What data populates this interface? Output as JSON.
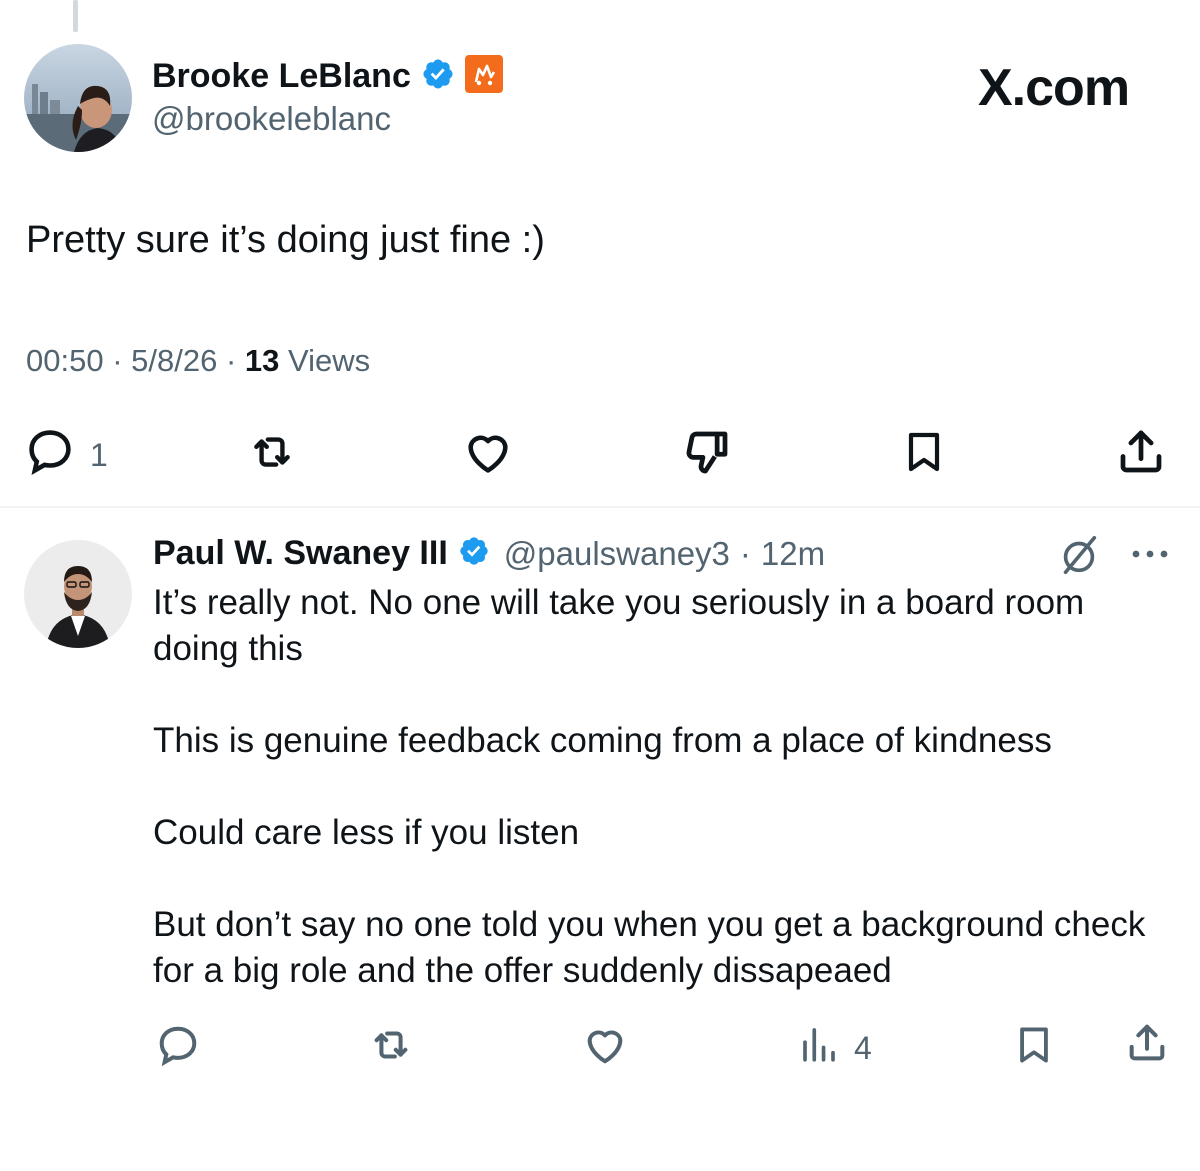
{
  "brand": {
    "logo_text": "X.com"
  },
  "main_post": {
    "author_name": "Brooke LeBlanc",
    "handle": "@brookeleblanc",
    "text": "Pretty sure it’s doing just fine :)",
    "time": "00:50",
    "date": "5/8/26",
    "views_count": "13",
    "views_label": "Views",
    "reply_count": "1"
  },
  "reply": {
    "author_name": "Paul W. Swaney III",
    "handle": "@paulswaney3",
    "time_ago": "12m",
    "paragraphs": [
      "It’s really not. No one will take you seriously in a board room doing this",
      "This is genuine feedback coming from a place of kindness",
      "Could care less if you listen",
      "But don’t say no one told you when you get a background check for a big role and the offer suddenly dissapeaed"
    ],
    "views_count": "4"
  },
  "icons": {
    "verified": "verified-badge-icon",
    "affiliate": "affiliate-badge-icon",
    "reply": "reply-icon",
    "repost": "repost-icon",
    "like": "heart-icon",
    "dislike": "dislike-icon",
    "bookmark": "bookmark-icon",
    "share": "share-icon",
    "analytics": "analytics-icon",
    "grok": "grok-icon",
    "more": "more-icon"
  },
  "colors": {
    "verified": "#1d9bf0",
    "affiliate": "#f26c1b",
    "secondary_text": "#536471"
  }
}
